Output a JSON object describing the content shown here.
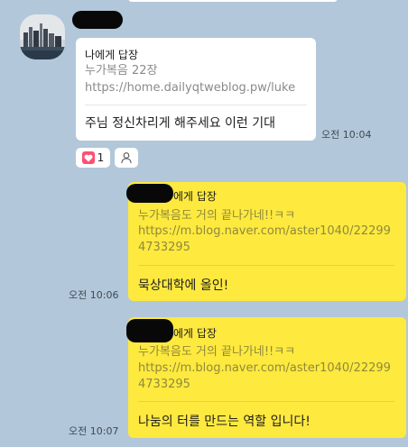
{
  "colors": {
    "background": "#b2c7d9",
    "incoming_bubble": "#ffffff",
    "outgoing_bubble": "#fee93f",
    "reaction_heart": "#ff4f72"
  },
  "incoming": {
    "reply_label": "나에게 답장",
    "quote_title": "누가복음 22장",
    "quote_url": "https://home.dailyqtweblog.pw/luke",
    "message": "주님 정신차리게 해주세요 이런 기대",
    "time": "오전 10:04",
    "reaction_count": "1",
    "reaction_icon": "heart-icon",
    "person_icon": "person-icon"
  },
  "outgoing": [
    {
      "reply_label": "에게 답장",
      "quote_title": "누가복음도 거의 끝나가네!!ㅋㅋ",
      "quote_url_1": "https://m.blog.naver.com/aster1040/22299",
      "quote_url_2": "4733295",
      "message": "묵상대학에 올인!",
      "time": "오전 10:06"
    },
    {
      "reply_label": "에게 답장",
      "quote_title": "누가복음도 거의 끝나가네!!ㅋㅋ",
      "quote_url_1": "https://m.blog.naver.com/aster1040/22299",
      "quote_url_2": "4733295",
      "message": "나눔의 터를 만드는 역할 입니다!",
      "time": "오전 10:07"
    }
  ]
}
